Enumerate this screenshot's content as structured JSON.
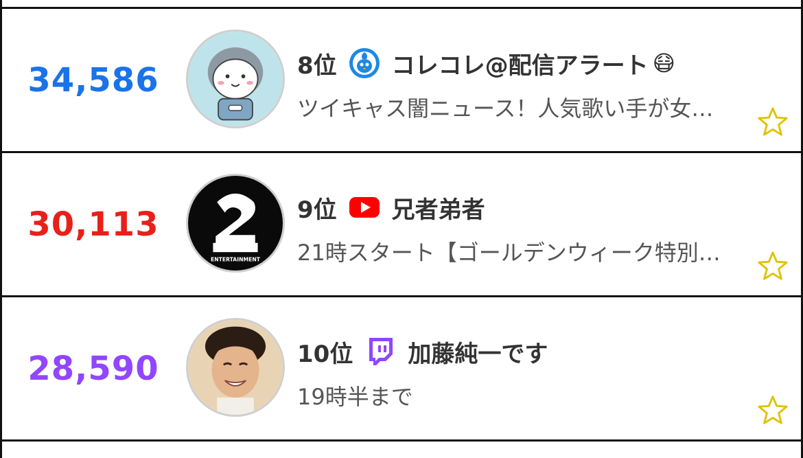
{
  "rows": [
    {
      "viewers": "34,586",
      "viewers_color": "#1a73e8",
      "rank": "8位",
      "platform_icon": "twitcasting-icon",
      "name": "コレコレ@配信アラート",
      "name_emoji": "😷",
      "subtitle": "ツイキャス闇ニュース！人気歌い手が女…"
    },
    {
      "viewers": "30,113",
      "viewers_color": "#e8201a",
      "rank": "9位",
      "platform_icon": "youtube-icon",
      "name": "兄者弟者",
      "name_emoji": "",
      "subtitle": "21時スタート【ゴールデンウィーク特別…"
    },
    {
      "viewers": "28,590",
      "viewers_color": "#9146ff",
      "rank": "10位",
      "platform_icon": "twitch-icon",
      "name": "加藤純一です",
      "name_emoji": "",
      "subtitle": "19時半まで"
    }
  ],
  "avatar2_text": "ENTERTAINMENT",
  "colors": {
    "star": "#e0c200",
    "youtube": "#ff0000",
    "twitch": "#9146ff",
    "twitcasting": "#1e88e5"
  }
}
